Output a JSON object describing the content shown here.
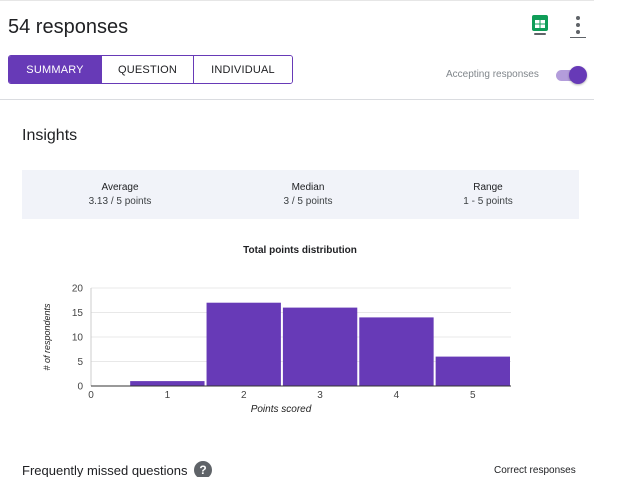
{
  "header": {
    "title": "54 responses",
    "tabs": [
      {
        "label": "SUMMARY",
        "active": true
      },
      {
        "label": "QUESTION",
        "active": false
      },
      {
        "label": "INDIVIDUAL",
        "active": false
      }
    ],
    "accepting_label": "Accepting responses",
    "accepting_on": true,
    "icons": [
      "sheets-icon",
      "more-vert-icon"
    ]
  },
  "insights": {
    "title": "Insights",
    "stats": [
      {
        "label": "Average",
        "value": "3.13 / 5 points"
      },
      {
        "label": "Median",
        "value": "3 / 5 points"
      },
      {
        "label": "Range",
        "value": "1 - 5 points"
      }
    ]
  },
  "chart_data": {
    "type": "bar",
    "title": "Total points distribution",
    "xlabel": "Points scored",
    "ylabel": "# of respondents",
    "x_ticks": [
      "0",
      "1",
      "2",
      "3",
      "4",
      "5"
    ],
    "y_ticks": [
      "0",
      "5",
      "10",
      "15",
      "20"
    ],
    "categories": [
      "1",
      "2",
      "3",
      "4",
      "5"
    ],
    "values": [
      1,
      17,
      16,
      14,
      6
    ],
    "ylim": [
      0,
      20
    ],
    "xlim": [
      0,
      5.5
    ],
    "grid": true,
    "color": "#673ab7"
  },
  "missed": {
    "title": "Frequently missed questions",
    "right_label": "Correct responses"
  },
  "colors": {
    "accent": "#673ab7",
    "toggle_track": "#b39ddb",
    "stats_bg": "#f1f3f9"
  }
}
